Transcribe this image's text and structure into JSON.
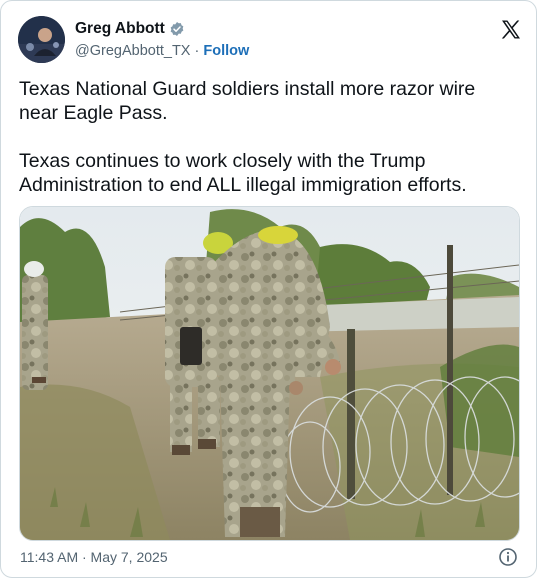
{
  "author": {
    "display_name": "Greg Abbott",
    "handle": "@GregAbbott_TX",
    "separator": " · ",
    "follow_label": "Follow"
  },
  "tweet": {
    "text": "Texas National Guard soldiers install more razor wire near Eagle Pass.\n\nTexas continues to work closely with the Trump Administration to end ALL illegal immigration efforts.",
    "timestamp": "11:43 AM · May 7, 2025"
  },
  "icons": {
    "verified": "verified-badge-icon",
    "platform": "x-logo-icon",
    "info": "info-icon"
  },
  "colors": {
    "verified": "#829aab",
    "follow": "#1d6fb8",
    "secondary_text": "#536471",
    "border": "#cfd9de"
  }
}
